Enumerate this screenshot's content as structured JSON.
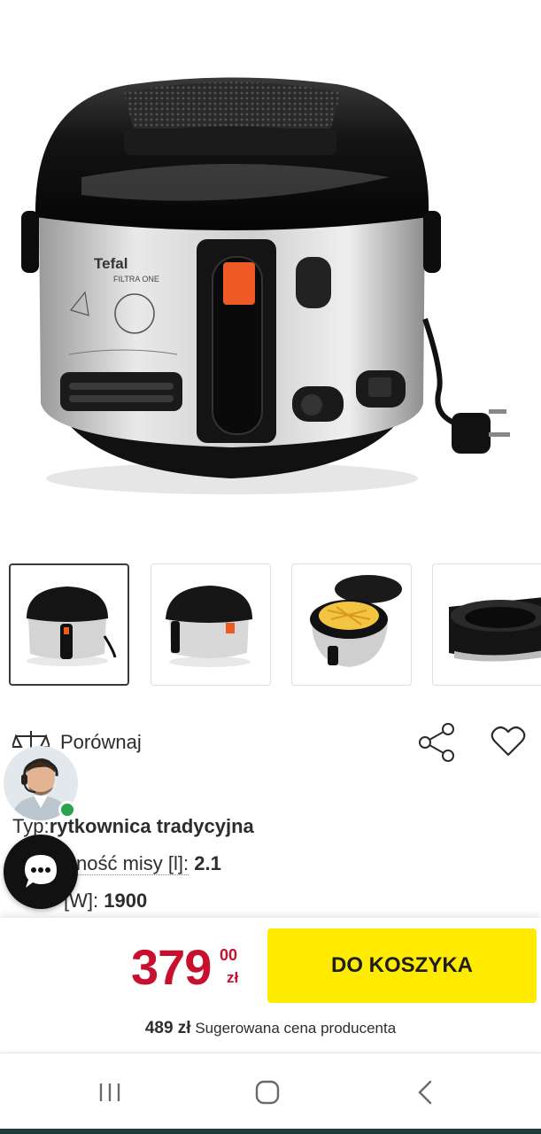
{
  "product": {
    "image_alt": "Tefal Filtra One fryer",
    "brand_on_device": "Tefal",
    "model_on_device": "FILTRA ONE"
  },
  "thumbnails": [
    {
      "name": "thumbnail-front",
      "active": true
    },
    {
      "name": "thumbnail-side",
      "active": false
    },
    {
      "name": "thumbnail-open-fries",
      "active": false
    },
    {
      "name": "thumbnail-basket",
      "active": false
    }
  ],
  "actions": {
    "compare_label": "Porównaj",
    "compare_icon": "scale-icon",
    "share_icon": "share-icon",
    "favorite_icon": "heart-icon"
  },
  "specs": [
    {
      "label": "Typ:",
      "value": "Frytkownica tradycyjna"
    },
    {
      "label": "Pojemność misy [l]:",
      "value": "2.1"
    },
    {
      "label": "Moc [W]:",
      "value": "1900"
    }
  ],
  "spec_display": {
    "typ_label": "Typ: ",
    "typ_value": "rytkownica tradycyjna",
    "misy_label": "ność misy [l]:",
    "misy_value": "2.1",
    "moc_label": "[W]:",
    "moc_value": "1900"
  },
  "buy": {
    "price_main": "379",
    "price_cents": "00",
    "currency": "zł",
    "cart_label": "DO KOSZYKA",
    "suggested_price": "489 zł",
    "suggested_label": "Sugerowana cena producenta"
  },
  "colors": {
    "price": "#c8102e",
    "cart_button": "#ffeb00",
    "online_dot": "#29a44a"
  },
  "navbar": {
    "recent_icon": "recent-apps-icon",
    "home_icon": "home-icon",
    "back_icon": "back-icon"
  }
}
